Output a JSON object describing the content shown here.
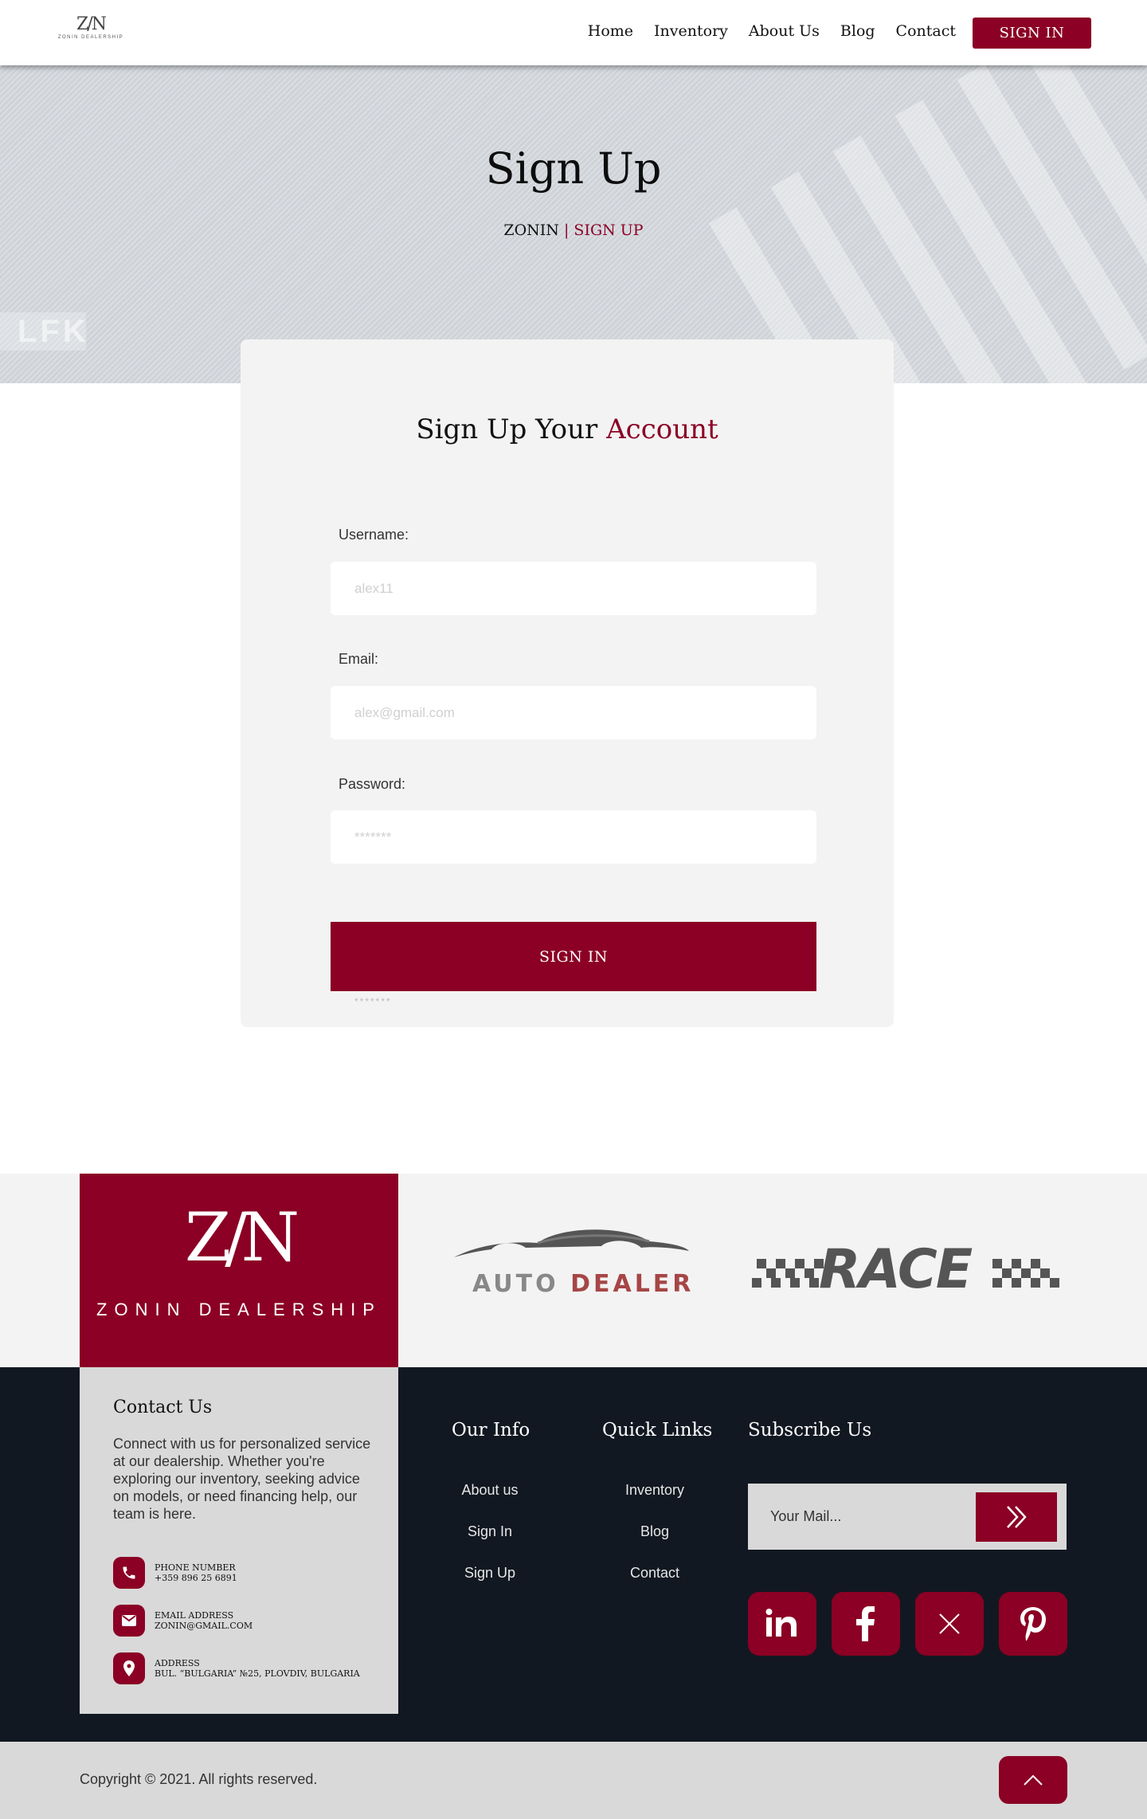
{
  "nav": {
    "logo_mark": "Z/N",
    "logo_word": "ZONIN DEALERSHIP",
    "links": [
      "Home",
      "Inventory",
      "About Us",
      "Blog",
      "Contact"
    ],
    "signin_label": "SIGN IN"
  },
  "hero": {
    "title": "Sign Up",
    "crumb_home": "ZONIN",
    "crumb_sep": " | ",
    "crumb_current": "SIGN UP",
    "plate_text": "LFK"
  },
  "form": {
    "title_plain": "Sign Up Your ",
    "title_accent": "Account",
    "username_label": "Username:",
    "username_placeholder": "alex11",
    "email_label": "Email:",
    "email_placeholder": "alex@gmail.com",
    "password_label": "Password:",
    "password_placeholder": "*******",
    "submit_label": "SIGN IN",
    "stray_text": "*******"
  },
  "brands": {
    "zonin_mark": "Z/N",
    "zonin_word": "ZONIN DEALERSHIP",
    "autodealer_a": "AUTO ",
    "autodealer_b": "DEALER",
    "race": "RACE"
  },
  "contact": {
    "title": "Contact Us",
    "text": "Connect with us for personalized service at our dealership. Whether you're exploring our inventory, seeking advice on models, or need financing help, our team is here.",
    "phone_label": "PHONE NUMBER",
    "phone_value": "+359 896 25 6891",
    "email_label": "EMAIL ADDRESS",
    "email_value": "ZONIN@GMAIL.COM",
    "address_label": "ADDRESS",
    "address_value": "BUL. “BULGARIA” №25, PLOVDIV, BULGARIA"
  },
  "footer": {
    "our_info_title": "Our Info",
    "our_info_links": [
      "About us",
      "Sign In",
      "Sign Up"
    ],
    "quick_links_title": "Quick Links",
    "quick_links": [
      "Inventory",
      "Blog",
      "Contact"
    ],
    "subscribe_title": "Subscribe Us",
    "subscribe_placeholder": "Your Mail...",
    "social": [
      "linkedin-icon",
      "facebook-icon",
      "x-icon",
      "pinterest-icon"
    ],
    "copyright": "Copyright © 2021. All rights reserved."
  },
  "colors": {
    "accent": "#8b0024",
    "footer_bg": "#121821",
    "light_bg": "#f3f3f3"
  }
}
